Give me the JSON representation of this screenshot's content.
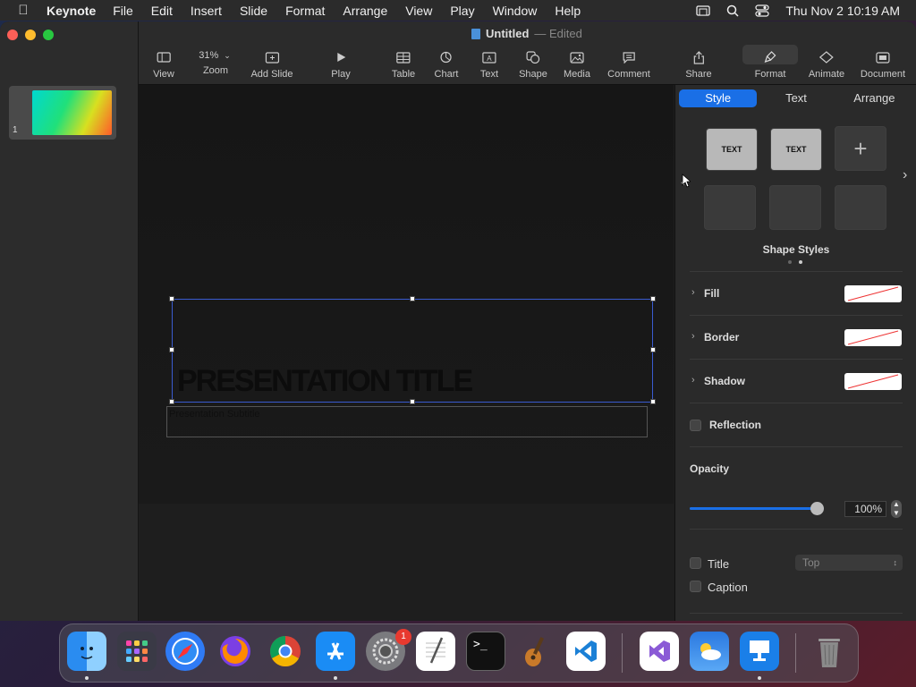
{
  "menubar": {
    "app_name": "Keynote",
    "items": [
      "File",
      "Edit",
      "Insert",
      "Slide",
      "Format",
      "Arrange",
      "View",
      "Play",
      "Window",
      "Help"
    ],
    "clock": "Thu Nov 2  10:19 AM"
  },
  "window": {
    "title": "Untitled",
    "title_suffix": "— Edited"
  },
  "toolbar": {
    "zoom_value": "31%",
    "items": {
      "view": "View",
      "zoom": "Zoom",
      "add_slide": "Add Slide",
      "play": "Play",
      "table": "Table",
      "chart": "Chart",
      "text": "Text",
      "shape": "Shape",
      "media": "Media",
      "comment": "Comment",
      "share": "Share",
      "format": "Format",
      "animate": "Animate",
      "document": "Document"
    }
  },
  "navigator": {
    "slide_number": "1"
  },
  "slide": {
    "title": "PRESENTATION TITLE",
    "subtitle": "Presentation Subtitle"
  },
  "inspector": {
    "tabs": [
      "Style",
      "Text",
      "Arrange"
    ],
    "active_tab": "Style",
    "style_tile_label": "TEXT",
    "shape_styles_label": "Shape Styles",
    "fill_label": "Fill",
    "border_label": "Border",
    "shadow_label": "Shadow",
    "reflection_label": "Reflection",
    "opacity_label": "Opacity",
    "opacity_value": "100%",
    "opacity_fraction": 1.0,
    "title_label": "Title",
    "title_position": "Top",
    "caption_label": "Caption"
  },
  "dock": {
    "apps": [
      "Finder",
      "Launchpad",
      "Safari",
      "Firefox",
      "Chrome",
      "App Store",
      "System Settings",
      "TextEdit",
      "Terminal",
      "GarageBand",
      "Visual Studio Code",
      "Visual Studio",
      "Weather",
      "Keynote",
      "Trash"
    ],
    "settings_badge": "1"
  }
}
